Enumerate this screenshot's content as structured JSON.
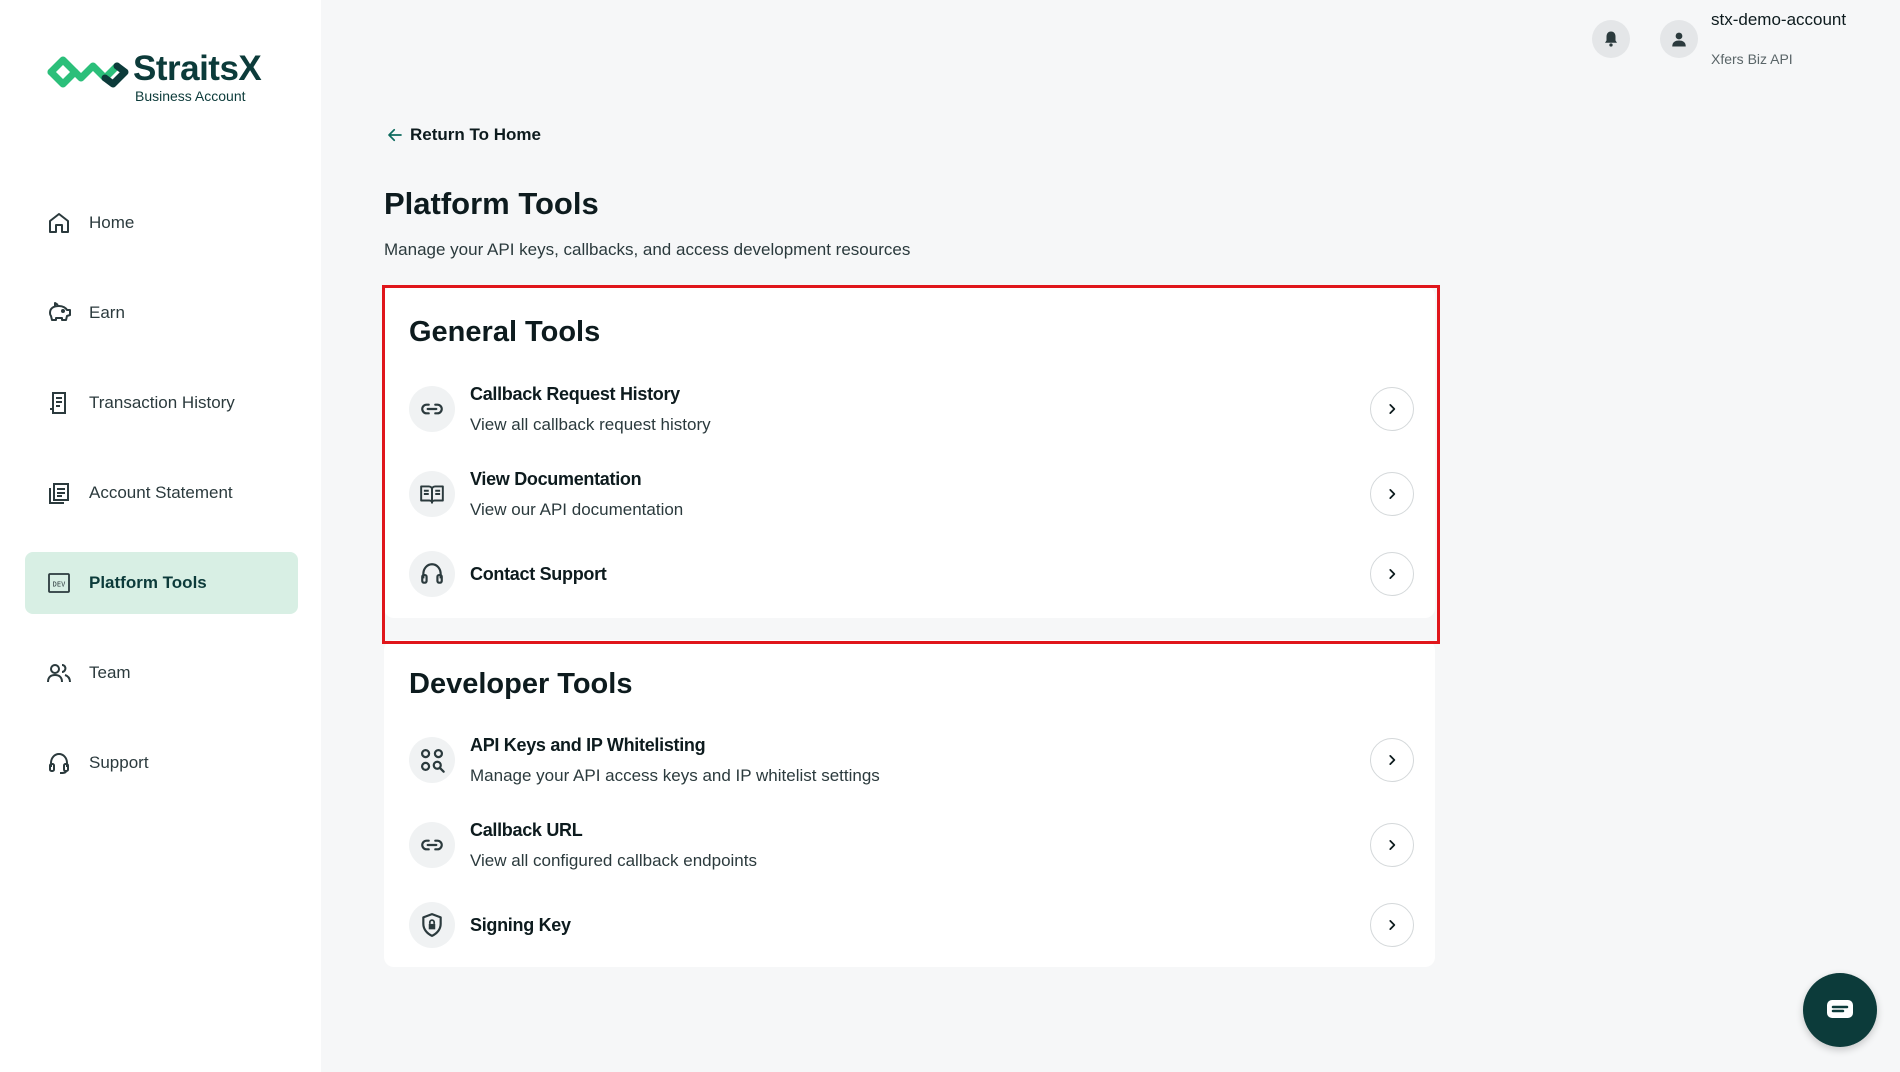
{
  "brand": {
    "name": "StraitsX",
    "subtitle": "Business Account",
    "accent": "#2bbf7a",
    "dark": "#0c3b3a"
  },
  "sidebar": {
    "items": [
      {
        "label": "Home",
        "icon": "home-icon",
        "active": false
      },
      {
        "label": "Earn",
        "icon": "piggy-bank-icon",
        "active": false
      },
      {
        "label": "Transaction History",
        "icon": "receipt-icon",
        "active": false
      },
      {
        "label": "Account Statement",
        "icon": "document-stack-icon",
        "active": false
      },
      {
        "label": "Platform Tools",
        "icon": "dev-icon",
        "active": true
      },
      {
        "label": "Team",
        "icon": "team-icon",
        "active": false
      },
      {
        "label": "Support",
        "icon": "headset-icon",
        "active": false
      }
    ]
  },
  "topbar": {
    "account_name": "stx-demo-account",
    "account_type": "Xfers Biz API",
    "bell_icon": "bell-icon",
    "avatar_icon": "user-icon"
  },
  "main": {
    "back_label": "Return To Home",
    "title": "Platform Tools",
    "description": "Manage your API keys, callbacks, and access development resources",
    "general_tools": {
      "title": "General Tools",
      "items": [
        {
          "title": "Callback Request History",
          "subtitle": "View all callback request history",
          "icon": "link-icon"
        },
        {
          "title": "View Documentation",
          "subtitle": "View our API documentation",
          "icon": "book-icon"
        },
        {
          "title": "Contact Support",
          "subtitle": "",
          "icon": "headset-icon"
        }
      ]
    },
    "developer_tools": {
      "title": "Developer Tools",
      "items": [
        {
          "title": "API Keys and IP Whitelisting",
          "subtitle": "Manage your API access keys and IP whitelist settings",
          "icon": "key-search-icon"
        },
        {
          "title": "Callback URL",
          "subtitle": "View all configured callback endpoints",
          "icon": "link-icon"
        },
        {
          "title": "Signing Key",
          "subtitle": "",
          "icon": "shield-lock-icon"
        }
      ]
    }
  },
  "highlight_color": "#e0161b",
  "chat_icon": "chat-icon"
}
